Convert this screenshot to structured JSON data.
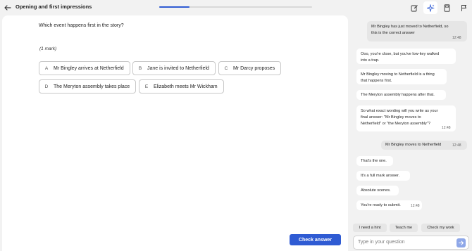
{
  "header": {
    "title": "Opening and first impressions",
    "progress": 0.2
  },
  "question": {
    "text": "Which event happens first in the story?",
    "marks": "(1 mark)",
    "options": [
      {
        "letter": "A",
        "text": "Mr Bingley arrives at Netherfield"
      },
      {
        "letter": "B",
        "text": "Jane is invited to Netherfield"
      },
      {
        "letter": "C",
        "text": "Mr Darcy proposes"
      },
      {
        "letter": "D",
        "text": "The Meryton assembly takes place"
      },
      {
        "letter": "E",
        "text": "Elizabeth meets Mr Wickham"
      }
    ],
    "check_label": "Check answer"
  },
  "chat": {
    "messages": [
      {
        "role": "user",
        "lines": [
          "Mr Bingley has just moved to Netherfield, so",
          "this is the correct answer"
        ],
        "time": "12:48"
      },
      {
        "role": "tutor",
        "lines": [
          "Ooo, you're close, but you've low-key walked",
          "into a trap."
        ]
      },
      {
        "role": "tutor",
        "lines": [
          "Mr Bingley moving to Netherfield is a thing",
          "that happens first."
        ]
      },
      {
        "role": "tutor",
        "lines": [
          "The Meryton assembly happens after that."
        ]
      },
      {
        "role": "tutor",
        "lines": [
          "So what exact wording will you write as your",
          "final answer: \"Mr Bingley moves to",
          "Netherfield\" or \"the Meryton assembly\"?"
        ],
        "time": "12:48"
      },
      {
        "role": "user",
        "lines": [
          "Mr Bingley moves to Netherfield"
        ],
        "time": "12:48"
      },
      {
        "role": "tutor",
        "lines": [
          "That's the one."
        ]
      },
      {
        "role": "tutor",
        "lines": [
          "It's a full mark answer."
        ]
      },
      {
        "role": "tutor",
        "lines": [
          "Absolute scenes."
        ]
      },
      {
        "role": "tutor",
        "lines": [
          "You're ready to submit."
        ],
        "time": "12:48"
      }
    ],
    "quick_replies": [
      "I need a hint",
      "Teach me",
      "Check my work"
    ],
    "input_placeholder": "Type in your question"
  }
}
